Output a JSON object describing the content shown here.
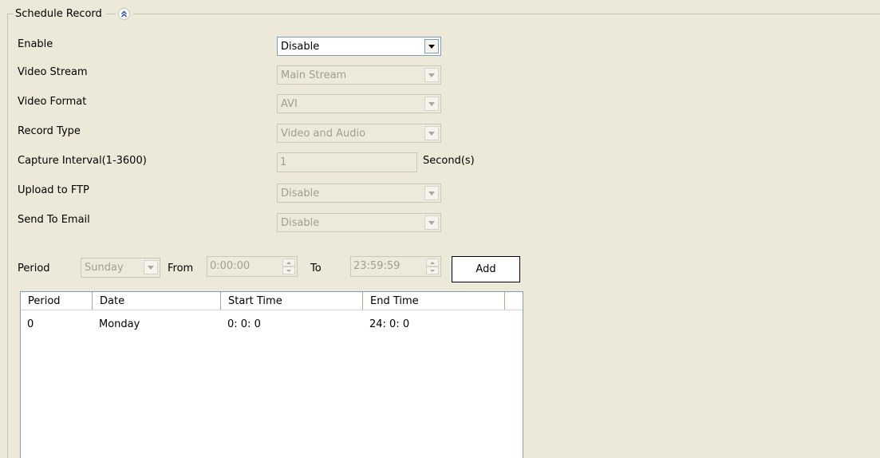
{
  "group": {
    "title": "Schedule Record",
    "collapse_icon": "double-chevron-up-icon"
  },
  "fields": {
    "enable": {
      "label": "Enable",
      "value": "Disable"
    },
    "video_stream": {
      "label": "Video Stream",
      "value": "Main Stream"
    },
    "video_format": {
      "label": "Video Format",
      "value": "AVI"
    },
    "record_type": {
      "label": "Record Type",
      "value": "Video and Audio"
    },
    "capture_interval": {
      "label": "Capture Interval(1-3600)",
      "value": "1",
      "unit": "Second(s)"
    },
    "upload_ftp": {
      "label": "Upload to FTP",
      "value": "Disable"
    },
    "send_email": {
      "label": "Send To Email",
      "value": "Disable"
    }
  },
  "period": {
    "label": "Period",
    "day": "Sunday",
    "from_label": "From",
    "from_value": "0:00:00",
    "to_label": "To",
    "to_value": "23:59:59",
    "add_label": "Add"
  },
  "table": {
    "columns": [
      "Period",
      "Date",
      "Start Time",
      "End Time"
    ],
    "rows": [
      [
        "0",
        "Monday",
        "0: 0: 0",
        "24: 0: 0"
      ]
    ]
  }
}
